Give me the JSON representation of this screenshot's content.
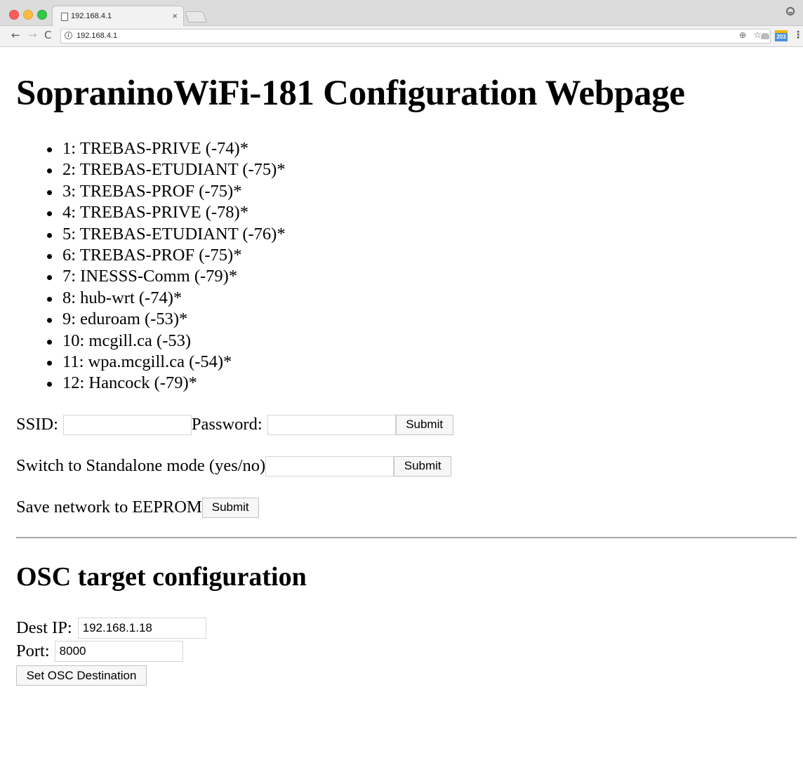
{
  "browser": {
    "tab_title": "192.168.4.1",
    "close_glyph": "×",
    "url": "192.168.4.1",
    "calendar_badge": "203"
  },
  "page": {
    "title": "SopraninoWiFi-181 Configuration Webpage",
    "networks": [
      "1: TREBAS-PRIVE (-74)*",
      "2: TREBAS-ETUDIANT (-75)*",
      "3: TREBAS-PROF (-75)*",
      "4: TREBAS-PRIVE (-78)*",
      "5: TREBAS-ETUDIANT (-76)*",
      "6: TREBAS-PROF (-75)*",
      "7: INESSS-Comm (-79)*",
      "8: hub-wrt (-74)*",
      "9: eduroam (-53)*",
      "10: mcgill.ca (-53)",
      "11: wpa.mcgill.ca (-54)*",
      "12: Hancock (-79)*"
    ],
    "network_form": {
      "ssid_label": "SSID:",
      "ssid_value": "",
      "password_label": "Password:",
      "password_value": "",
      "submit_label": "Submit"
    },
    "standalone_form": {
      "label": "Switch to Standalone mode (yes/no)",
      "value": "",
      "submit_label": "Submit"
    },
    "eeprom_form": {
      "label": "Save network to EEPROM",
      "submit_label": "Submit"
    },
    "osc": {
      "heading": "OSC target configuration",
      "dest_ip_label": "Dest IP:",
      "dest_ip_value": "192.168.1.18",
      "port_label": "Port:",
      "port_value": "8000",
      "set_button_label": "Set OSC Destination"
    }
  },
  "colors": {
    "page_background": "#ffffff",
    "chrome_background": "#f2f2f2",
    "traffic_red": "#fc605b",
    "traffic_yellow": "#fdbc40",
    "traffic_green": "#34c84a"
  },
  "icons": [
    "document-icon",
    "close-icon",
    "back-icon",
    "forward-icon",
    "reload-icon",
    "info-icon",
    "zoom-icon",
    "star-icon",
    "drive-icon",
    "calendar-icon",
    "menu-icon",
    "profile-icon"
  ]
}
